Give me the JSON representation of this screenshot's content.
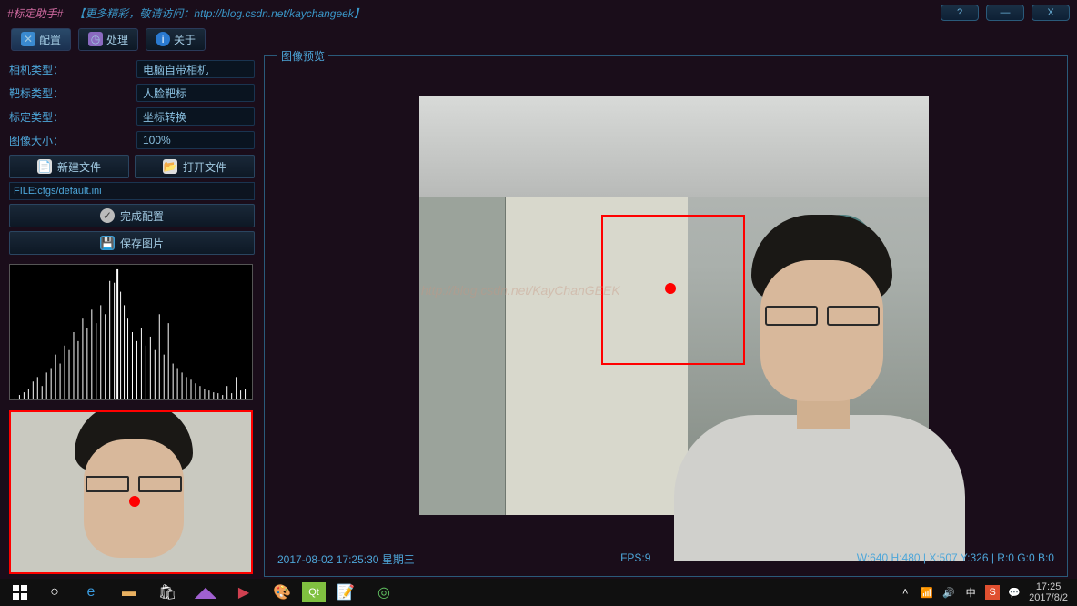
{
  "title": {
    "app": "#标定助手#",
    "subtitle": "【更多精彩，敬请访问：http://blog.csdn.net/kaychangeek】"
  },
  "toolbar": {
    "config": "配置",
    "process": "处理",
    "about": "关于"
  },
  "config": {
    "camera_type_label": "相机类型：",
    "camera_type_value": "电脑自带相机",
    "target_type_label": "靶标类型：",
    "target_type_value": "人脸靶标",
    "calib_type_label": "标定类型：",
    "calib_type_value": "坐标转换",
    "image_size_label": "图像大小：",
    "image_size_value": "100%",
    "new_file": "新建文件",
    "open_file": "打开文件",
    "file_path": "FILE:cfgs/default.ini",
    "finish_config": "完成配置",
    "save_image": "保存图片"
  },
  "preview": {
    "title": "图像预览",
    "watermark": "http://blog.csdn.net/KayChanGEEK",
    "timestamp": "2017-08-02 17:25:30 星期三",
    "fps": "FPS:9",
    "info": "W:640 H:480  |  X:507 Y:326  |  R:0 G:0 B:0"
  },
  "taskbar": {
    "time": "17:25",
    "date": "2017/8/2"
  },
  "win": {
    "help": "?",
    "min": "—",
    "close": "X"
  }
}
